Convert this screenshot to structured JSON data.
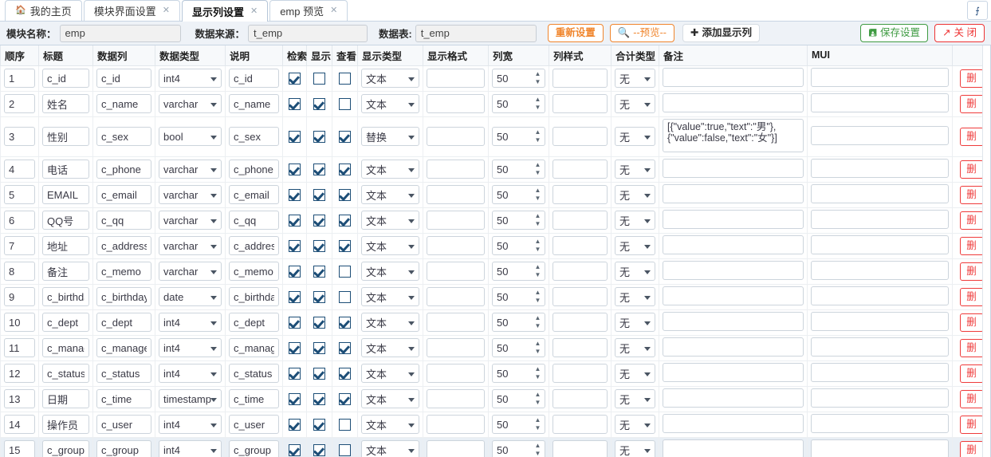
{
  "tabs": [
    {
      "label": "我的主页",
      "icon": "home-icon",
      "active": false,
      "closable": false
    },
    {
      "label": "模块界面设置",
      "active": false,
      "closable": true
    },
    {
      "label": "显示列设置",
      "active": true,
      "closable": true
    },
    {
      "label": "emp 预览",
      "active": false,
      "closable": true
    }
  ],
  "tab_dropdown_icon": "chevron-double-down-icon",
  "toolbar": {
    "module_label": "模块名称：",
    "module_value": "emp",
    "source_label": "数据来源：",
    "source_value": "t_emp",
    "table_label": "数据表:",
    "table_value": "t_emp",
    "reset_label": "重新设置",
    "preview_label": "--预览--",
    "preview_icon": "search-icon",
    "add_label": "添加显示列",
    "add_icon": "plus-icon",
    "save_label": "保存设置",
    "save_icon": "save-icon",
    "close_label": "关 闭",
    "close_icon": "external-link-icon"
  },
  "grid": {
    "columns": [
      "顺序",
      "标题",
      "数据列",
      "数据类型",
      "说明",
      "检索",
      "显示",
      "查看",
      "显示类型",
      "显示格式",
      "列宽",
      "列样式",
      "合计类型",
      "备注",
      "MUI",
      ""
    ],
    "defaults": {
      "width": "50",
      "total_type": "无",
      "display_type_text": "文本",
      "display_type_replace": "替换"
    },
    "rows": [
      {
        "order": "1",
        "title": "c_id",
        "column": "c_id",
        "datatype": "int4",
        "desc": "c_id",
        "search": true,
        "show": false,
        "view": false,
        "disptype": "文本",
        "format": "",
        "width": "50",
        "style": "",
        "total": "无",
        "remark": "",
        "mui": "",
        "del": "删"
      },
      {
        "order": "2",
        "title": "姓名",
        "column": "c_name",
        "datatype": "varchar",
        "desc": "c_name",
        "search": true,
        "show": true,
        "view": false,
        "disptype": "文本",
        "format": "",
        "width": "50",
        "style": "",
        "total": "无",
        "remark": "",
        "mui": "",
        "del": "删"
      },
      {
        "order": "3",
        "title": "性别",
        "column": "c_sex",
        "datatype": "bool",
        "desc": "c_sex",
        "search": true,
        "show": true,
        "view": true,
        "disptype": "替换",
        "format": "",
        "width": "50",
        "style": "",
        "total": "无",
        "remark": "[{\"value\":true,\"text\":\"男\"},\n{\"value\":false,\"text\":\"女\"}]",
        "mui": "",
        "del": "删",
        "tall": true
      },
      {
        "order": "4",
        "title": "电话",
        "column": "c_phone",
        "datatype": "varchar",
        "desc": "c_phone",
        "search": true,
        "show": true,
        "view": true,
        "disptype": "文本",
        "format": "",
        "width": "50",
        "style": "",
        "total": "无",
        "remark": "",
        "mui": "",
        "del": "删"
      },
      {
        "order": "5",
        "title": "EMAIL",
        "column": "c_email",
        "datatype": "varchar",
        "desc": "c_email",
        "search": true,
        "show": true,
        "view": true,
        "disptype": "文本",
        "format": "",
        "width": "50",
        "style": "",
        "total": "无",
        "remark": "",
        "mui": "",
        "del": "删"
      },
      {
        "order": "6",
        "title": "QQ号",
        "column": "c_qq",
        "datatype": "varchar",
        "desc": "c_qq",
        "search": true,
        "show": true,
        "view": true,
        "disptype": "文本",
        "format": "",
        "width": "50",
        "style": "",
        "total": "无",
        "remark": "",
        "mui": "",
        "del": "删"
      },
      {
        "order": "7",
        "title": "地址",
        "column": "c_address",
        "datatype": "varchar",
        "desc": "c_address",
        "search": true,
        "show": true,
        "view": true,
        "disptype": "文本",
        "format": "",
        "width": "50",
        "style": "",
        "total": "无",
        "remark": "",
        "mui": "",
        "del": "删"
      },
      {
        "order": "8",
        "title": "备注",
        "column": "c_memo",
        "datatype": "varchar",
        "desc": "c_memo",
        "search": true,
        "show": true,
        "view": false,
        "disptype": "文本",
        "format": "",
        "width": "50",
        "style": "",
        "total": "无",
        "remark": "",
        "mui": "",
        "del": "删"
      },
      {
        "order": "9",
        "title": "c_birthday",
        "column": "c_birthday",
        "datatype": "date",
        "desc": "c_birthday",
        "search": true,
        "show": true,
        "view": false,
        "disptype": "文本",
        "format": "",
        "width": "50",
        "style": "",
        "total": "无",
        "remark": "",
        "mui": "",
        "del": "删"
      },
      {
        "order": "10",
        "title": "c_dept",
        "column": "c_dept",
        "datatype": "int4",
        "desc": "c_dept",
        "search": true,
        "show": true,
        "view": true,
        "disptype": "文本",
        "format": "",
        "width": "50",
        "style": "",
        "total": "无",
        "remark": "",
        "mui": "",
        "del": "删"
      },
      {
        "order": "11",
        "title": "c_manager",
        "column": "c_manager",
        "datatype": "int4",
        "desc": "c_manager",
        "search": true,
        "show": true,
        "view": true,
        "disptype": "文本",
        "format": "",
        "width": "50",
        "style": "",
        "total": "无",
        "remark": "",
        "mui": "",
        "del": "删"
      },
      {
        "order": "12",
        "title": "c_status",
        "column": "c_status",
        "datatype": "int4",
        "desc": "c_status",
        "search": true,
        "show": true,
        "view": true,
        "disptype": "文本",
        "format": "",
        "width": "50",
        "style": "",
        "total": "无",
        "remark": "",
        "mui": "",
        "del": "删"
      },
      {
        "order": "13",
        "title": "日期",
        "column": "c_time",
        "datatype": "timestamp",
        "desc": "c_time",
        "search": true,
        "show": true,
        "view": true,
        "disptype": "文本",
        "format": "",
        "width": "50",
        "style": "",
        "total": "无",
        "remark": "",
        "mui": "",
        "del": "删"
      },
      {
        "order": "14",
        "title": "操作员",
        "column": "c_user",
        "datatype": "int4",
        "desc": "c_user",
        "search": true,
        "show": true,
        "view": false,
        "disptype": "文本",
        "format": "",
        "width": "50",
        "style": "",
        "total": "无",
        "remark": "",
        "mui": "",
        "del": "删"
      },
      {
        "order": "15",
        "title": "c_group",
        "column": "c_group",
        "datatype": "int4",
        "desc": "c_group",
        "search": true,
        "show": true,
        "view": false,
        "disptype": "文本",
        "format": "",
        "width": "50",
        "style": "",
        "total": "无",
        "remark": "",
        "mui": "",
        "del": "删",
        "focused": true
      }
    ]
  },
  "colors": {
    "accent_orange": "#f0852c",
    "accent_green": "#3f9b42",
    "accent_red": "#ee3333",
    "checkbox_navy": "#1d4e77",
    "header_bg": "#f7f9fb",
    "toolbar_bg": "#eef2f7"
  }
}
